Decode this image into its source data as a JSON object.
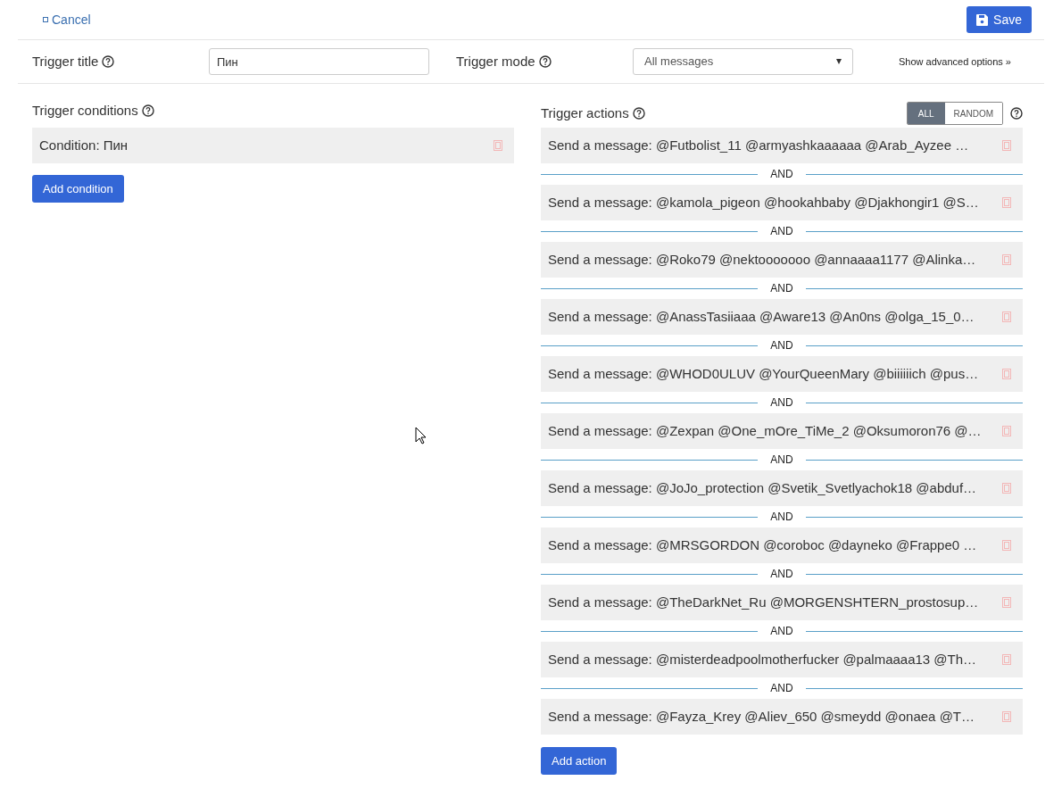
{
  "header": {
    "cancel": "Cancel",
    "save": "Save"
  },
  "settings": {
    "title_label": "Trigger title",
    "title_value": "Пин",
    "mode_label": "Trigger mode",
    "mode_value": "All messages",
    "advanced": "Show advanced options »"
  },
  "conditions": {
    "heading": "Trigger conditions",
    "items": [
      "Condition: Пин"
    ],
    "add": "Add condition"
  },
  "actions": {
    "heading": "Trigger actions",
    "modes": [
      {
        "label": "ALL",
        "selected": true
      },
      {
        "label": "RANDOM",
        "selected": false
      }
    ],
    "add": "Add action",
    "items": [
      {
        "text": "Send a message: @Futbolist_11 @armyashkaaaaaa @Arab_Ayzee …"
      },
      {
        "separator": "AND",
        "text": "Send a message: @kamola_pigeon @hookahbaby @Djakhongir1 @S…"
      },
      {
        "separator": "AND",
        "text": "Send a message: @Roko79 @nektooooooo @annaaaa1177 @Alinka…"
      },
      {
        "separator": "AND",
        "text": "Send a message: @AnassTasiiaaa @Aware13 @An0ns @olga_15_0…"
      },
      {
        "separator": "AND",
        "text": "Send a message: @WHOD0ULUV @YourQueenMary @biiiiiich @pus…"
      },
      {
        "separator": "AND",
        "text": "Send a message: @Zexpan @One_mOre_TiMe_2 @Oksumoron76 @…"
      },
      {
        "separator": "AND",
        "text": "Send a message: @JoJo_protection @Svetik_Svetlyachok18 @abduf…"
      },
      {
        "separator": "AND",
        "text": "Send a message: @MRSGORDON @coroboc @dayneko @Frappe0 …"
      },
      {
        "separator": "AND",
        "text": "Send a message: @TheDarkNet_Ru @MORGENSHTERN_prostosup…"
      },
      {
        "separator": "AND",
        "text": "Send a message: @misterdeadpoolmotherfucker @palmaaaa13 @Th…"
      },
      {
        "separator": "AND",
        "text": "Send a message: @Fayza_Krey @Aliev_650 @smeydd @onaea @T…"
      }
    ]
  }
}
